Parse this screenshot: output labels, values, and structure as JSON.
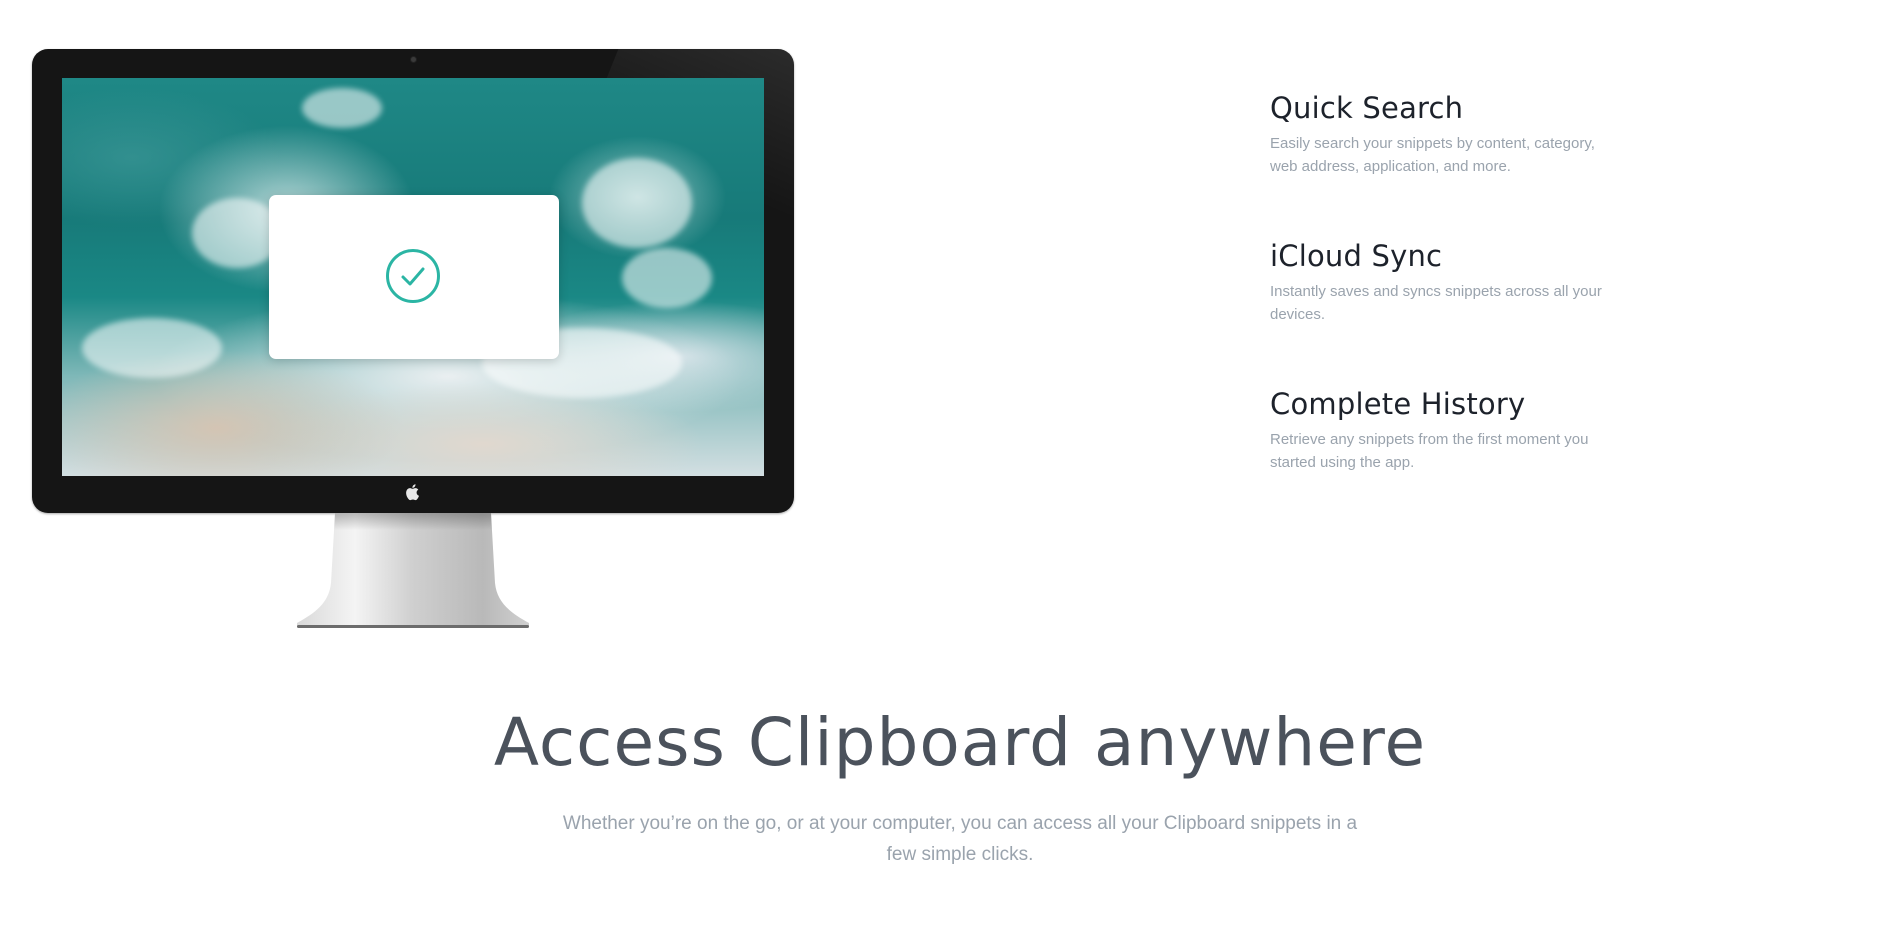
{
  "features": [
    {
      "title": "Quick Search",
      "description": "Easily search your snippets by content, category, web address, application, and more."
    },
    {
      "title": "iCloud Sync",
      "description": "Instantly saves and syncs snippets across all your devices."
    },
    {
      "title": "Complete History",
      "description": "Retrieve any snippets from the first moment you started using the app."
    }
  ],
  "section": {
    "headline": "Access Clipboard anywhere",
    "subtext": "Whether you’re on the go, or at your computer, you can access all your Clipboard snippets in a few simple clicks."
  },
  "icons": {
    "dialog_icon": "checkmark-circle-icon",
    "monitor_logo": "apple-logo-icon"
  },
  "colors": {
    "accent": "#2bb5a4",
    "heading": "#1d222b",
    "muted": "#9aa3ad",
    "headline": "#4b525c"
  }
}
